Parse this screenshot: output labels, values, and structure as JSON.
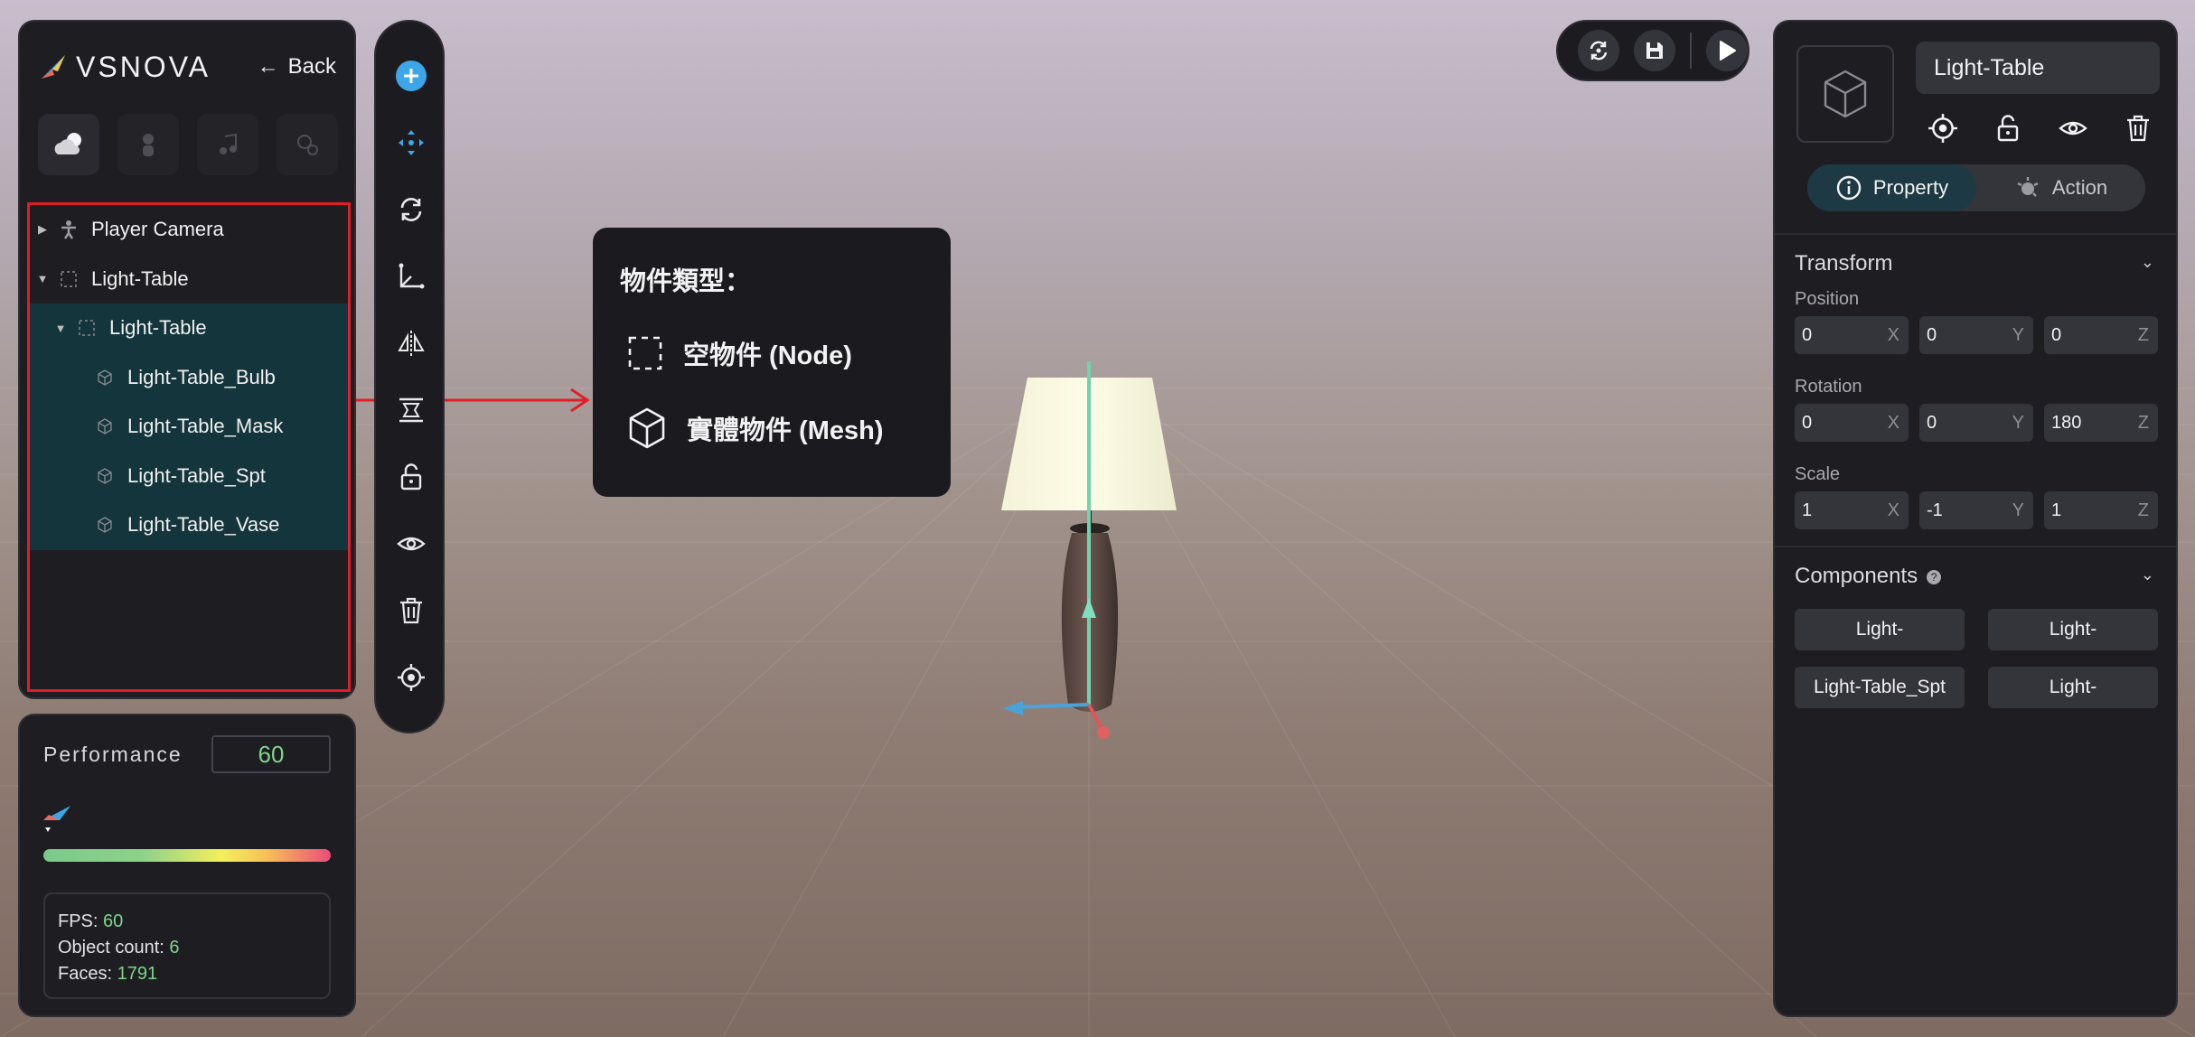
{
  "app": {
    "logo_text": "VSNOVA",
    "back_label": "Back"
  },
  "hierarchy": {
    "items": [
      {
        "label": "Player Camera",
        "icon": "person-icon",
        "expanded": false
      },
      {
        "label": "Light-Table",
        "icon": "node-icon",
        "expanded": true
      },
      {
        "label": "Light-Table",
        "icon": "node-icon",
        "expanded": true
      },
      {
        "label": "Light-Table_Bulb",
        "icon": "mesh-icon"
      },
      {
        "label": "Light-Table_Mask",
        "icon": "mesh-icon"
      },
      {
        "label": "Light-Table_Spt",
        "icon": "mesh-icon"
      },
      {
        "label": "Light-Table_Vase",
        "icon": "mesh-icon"
      }
    ]
  },
  "performance": {
    "label": "Performance",
    "value": "60",
    "stats": {
      "fps_label": "FPS: ",
      "fps": "60",
      "objects_label": "Object count: ",
      "objects": "6",
      "faces_label": "Faces: ",
      "faces": "1791"
    }
  },
  "tooltip": {
    "title": "物件類型：",
    "node_label": "空物件 (Node)",
    "mesh_label": "實體物件 (Mesh)"
  },
  "inspector": {
    "object_name": "Light-Table",
    "tabs": {
      "property": "Property",
      "action": "Action"
    },
    "transform": {
      "title": "Transform",
      "position_label": "Position",
      "rotation_label": "Rotation",
      "scale_label": "Scale",
      "position": {
        "x": "0",
        "y": "0",
        "z": "0"
      },
      "rotation": {
        "x": "0",
        "y": "0",
        "z": "180"
      },
      "scale": {
        "x": "1",
        "y": "-1",
        "z": "1"
      },
      "axis": {
        "x": "X",
        "y": "Y",
        "z": "Z"
      }
    },
    "components": {
      "title": "Components",
      "items": [
        "Light-",
        "Light-",
        "Light-Table_Spt",
        "Light-"
      ]
    }
  },
  "colors": {
    "accent_blue": "#3da6e8",
    "selected_row": "#14353c",
    "highlight_red": "#e11d25",
    "value_green": "#7fd38a"
  }
}
